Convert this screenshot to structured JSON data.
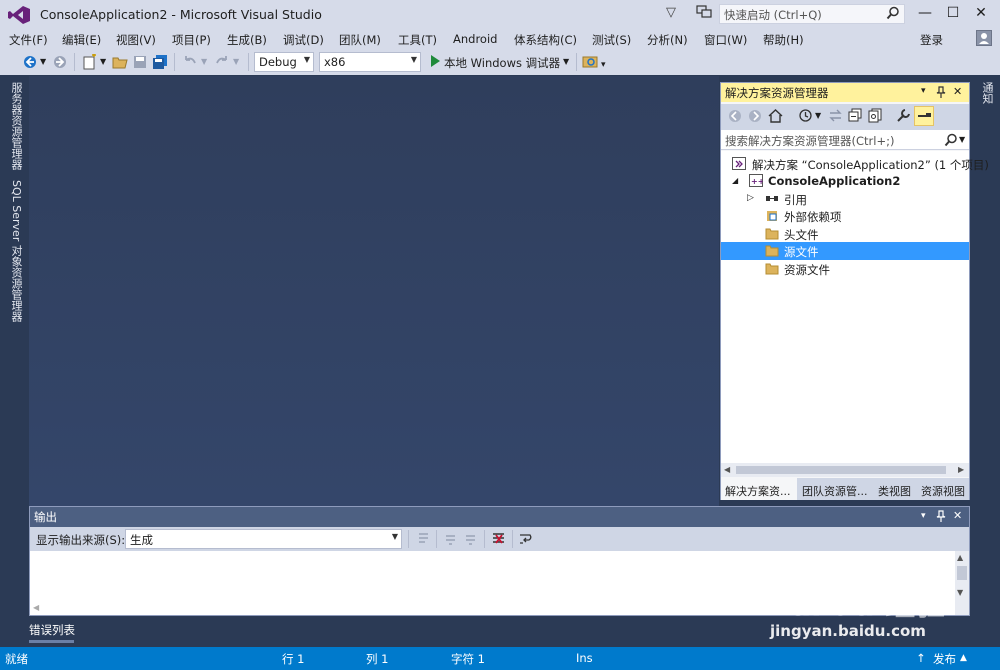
{
  "window": {
    "title": "ConsoleApplication2 - Microsoft Visual Studio",
    "quick_launch_placeholder": "快速启动 (Ctrl+Q)",
    "minimize": "—",
    "maximize": "☐",
    "close": "✕"
  },
  "menu": {
    "items": [
      "文件(F)",
      "编辑(E)",
      "视图(V)",
      "项目(P)",
      "生成(B)",
      "调试(D)",
      "团队(M)",
      "工具(T)",
      "Android",
      "体系结构(C)",
      "测试(S)",
      "分析(N)",
      "窗口(W)",
      "帮助(H)"
    ],
    "login": "登录"
  },
  "toolbar": {
    "configuration": "Debug",
    "platform": "x86",
    "run_label": "本地 Windows 调试器"
  },
  "left_tabs": [
    "服务器资源管理器",
    "SQL Server 对象资源管理器"
  ],
  "right_tabs": [
    "通知"
  ],
  "solution_explorer": {
    "title": "解决方案资源管理器",
    "header_controls": [
      "▾",
      "ᵖ",
      "✕"
    ],
    "search_placeholder": "搜索解决方案资源管理器(Ctrl+;)",
    "tree": [
      {
        "label": "解决方案 “ConsoleApplication2” (1 个项目)",
        "level": 0,
        "icon": "solution-icon",
        "expander": ""
      },
      {
        "label": "ConsoleApplication2",
        "level": 1,
        "icon": "project-icon",
        "expander": "◢",
        "bold": true
      },
      {
        "label": "引用",
        "level": 2,
        "icon": "references-icon",
        "expander": "▷"
      },
      {
        "label": "外部依赖项",
        "level": 2,
        "icon": "external-deps-icon",
        "expander": ""
      },
      {
        "label": "头文件",
        "level": 2,
        "icon": "folder-icon",
        "expander": ""
      },
      {
        "label": "源文件",
        "level": 2,
        "icon": "folder-icon",
        "expander": "",
        "selected": true
      },
      {
        "label": "资源文件",
        "level": 2,
        "icon": "folder-icon",
        "expander": ""
      }
    ],
    "bottom_tabs": [
      "解决方案资...",
      "团队资源管...",
      "类视图",
      "资源视图"
    ]
  },
  "output": {
    "title": "输出",
    "source_label": "显示输出来源(S):",
    "source_value": "生成"
  },
  "error_list_tab": "错误列表",
  "status": {
    "ready": "就绪",
    "line": "行 1",
    "col": "列 1",
    "char": "字符 1",
    "ins": "Ins",
    "publish": "发布"
  },
  "watermark": {
    "brand": "Bai du 经验",
    "url": "jingyan.baidu.com"
  },
  "colors": {
    "accent": "#007acc",
    "selection": "#3399ff",
    "panel_header_active": "#fff29d"
  }
}
